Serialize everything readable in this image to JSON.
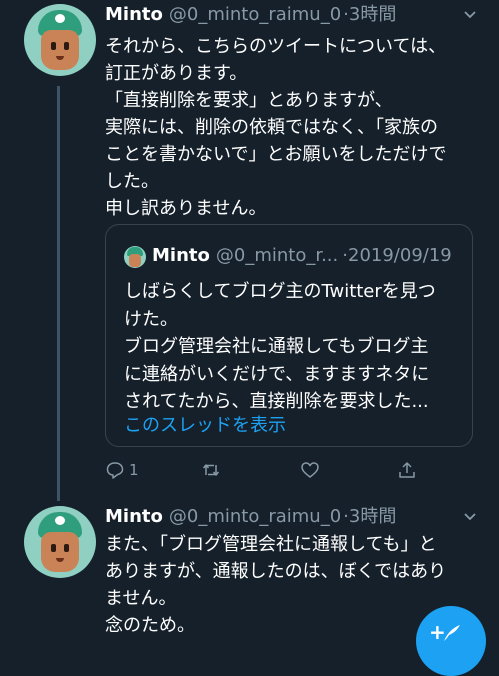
{
  "tweet1": {
    "name": "Minto",
    "handle": "@0_minto_raimu_0",
    "time": "3時間",
    "text": "それから、こちらのツイートについては、\n訂正があります。\n「直接削除を要求」とありますが、\n実際には、削除の依頼ではなく、「家族の\nことを書かないで」とお願いをしただけで\nした。\n申し訳ありません。",
    "quote": {
      "name": "Minto",
      "handle": "@0_minto_r...",
      "date": "2019/09/19",
      "text": "しばらくしてブログ主のTwitterを見つ\nけた。\nブログ管理会社に通報してもブログ主\nに連絡がいくだけで、ますますネタに\nされてたから、直接削除を要求した...",
      "show_thread": "このスレッドを表示"
    },
    "actions": {
      "reply_count": "1"
    }
  },
  "tweet2": {
    "name": "Minto",
    "handle": "@0_minto_raimu_0",
    "time": "3時間",
    "text": "また、「ブログ管理会社に通報しても」と\nありますが、通報したのは、ぼくではあり\nません。\n念のため。"
  },
  "colors": {
    "background": "#15202b",
    "accent": "#1da1f2",
    "secondary_text": "#8899a6",
    "border": "#38444d"
  },
  "icons": {
    "reply": "reply-icon",
    "retweet": "retweet-icon",
    "like": "heart-icon",
    "share": "share-icon",
    "caret": "chevron-down-icon",
    "compose": "compose-tweet-icon"
  }
}
